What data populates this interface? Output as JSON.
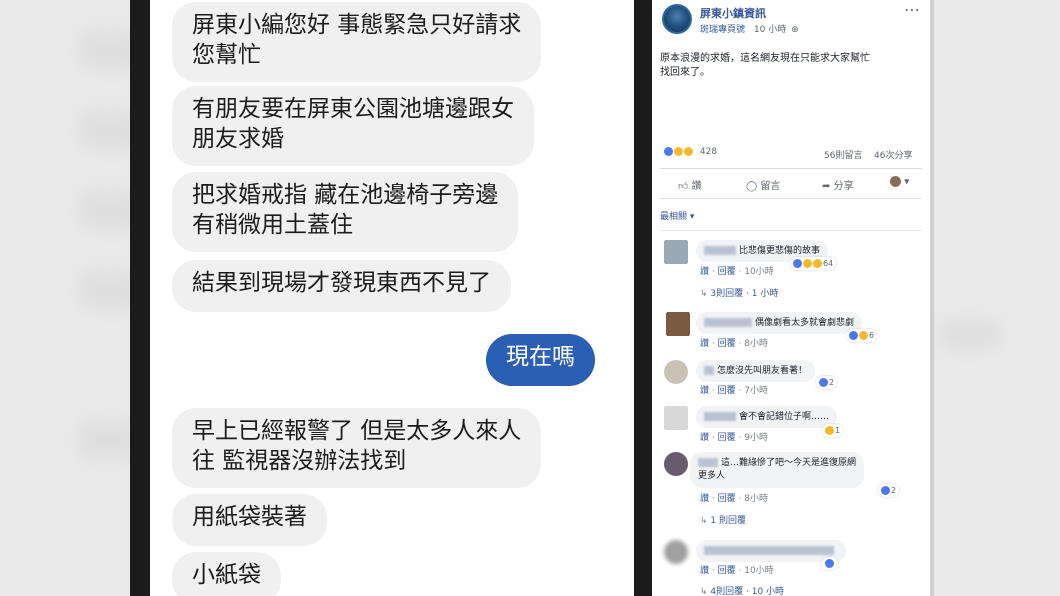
{
  "chat": {
    "messages": [
      {
        "text1": "屏東小編您好 事態緊急只好請求",
        "text2": "您幫忙"
      },
      {
        "text1": "有朋友要在屏東公園池塘邊跟女",
        "text2": "朋友求婚"
      },
      {
        "text1": "把求婚戒指 藏在池邊椅子旁邊",
        "text2": "有稍微用土蓋住"
      },
      {
        "text1": "結果到現場才發現東西不見了"
      },
      {
        "text1": "現在嗎"
      },
      {
        "text1": "早上已經報警了 但是太多人來人",
        "text2": "往 監視器沒辦法找到"
      },
      {
        "text1": "用紙袋裝著"
      },
      {
        "text1": "小紙袋"
      }
    ]
  },
  "post": {
    "page_name": "屏東小鎮資訊",
    "author_line": "斑瑞專頁號",
    "time": "10 小時",
    "body_line1": "原本浪漫的求婚，這名網友現在只能求大家幫忙",
    "body_line2": "找回來了。",
    "more_icon": "⋯",
    "reaction_count": "428",
    "comments_count": "56則留言",
    "shares_count": "46次分享",
    "actions": {
      "like": "讚",
      "comment": "留言",
      "share": "分享"
    },
    "sort_label": "最相關",
    "colors": {
      "fb_blue": "#385898",
      "like_blue": "#4a78ef",
      "haha_yellow": "#f7b928",
      "love_red": "#e9435a",
      "bubble_blue": "#2b5fb3"
    }
  },
  "comments": [
    {
      "text": "比悲傷更悲傷的故事",
      "meta_like": "讚",
      "meta_reply": "回覆",
      "time": "10小時",
      "reactions": "64"
    },
    {
      "text": "偶像劇看太多就會劇悲劇",
      "meta_like": "讚",
      "meta_reply": "回覆",
      "time": "8小時",
      "reactions": "6"
    },
    {
      "text": "怎麼沒先叫朋友看著！",
      "meta_like": "讚",
      "meta_reply": "回覆",
      "time": "7小時",
      "reactions": "2"
    },
    {
      "text": "會不會記錯位子啊……",
      "meta_like": "讚",
      "meta_reply": "回覆",
      "time": "9小時",
      "reactions": "1"
    },
    {
      "text1": "這…難綠慘了吧～今天是進復原網",
      "text2": "更多人",
      "meta_like": "讚",
      "meta_reply": "回覆",
      "time": "8小時",
      "reactions": "2"
    },
    {
      "meta_like": "讚",
      "meta_reply": "回覆",
      "time": "10小時",
      "reactions": ""
    }
  ],
  "replies": [
    {
      "text": "3則回覆 · 1 小時"
    },
    {
      "text": "1 則回覆"
    },
    {
      "text": "4則回覆 · 10 小時"
    }
  ]
}
